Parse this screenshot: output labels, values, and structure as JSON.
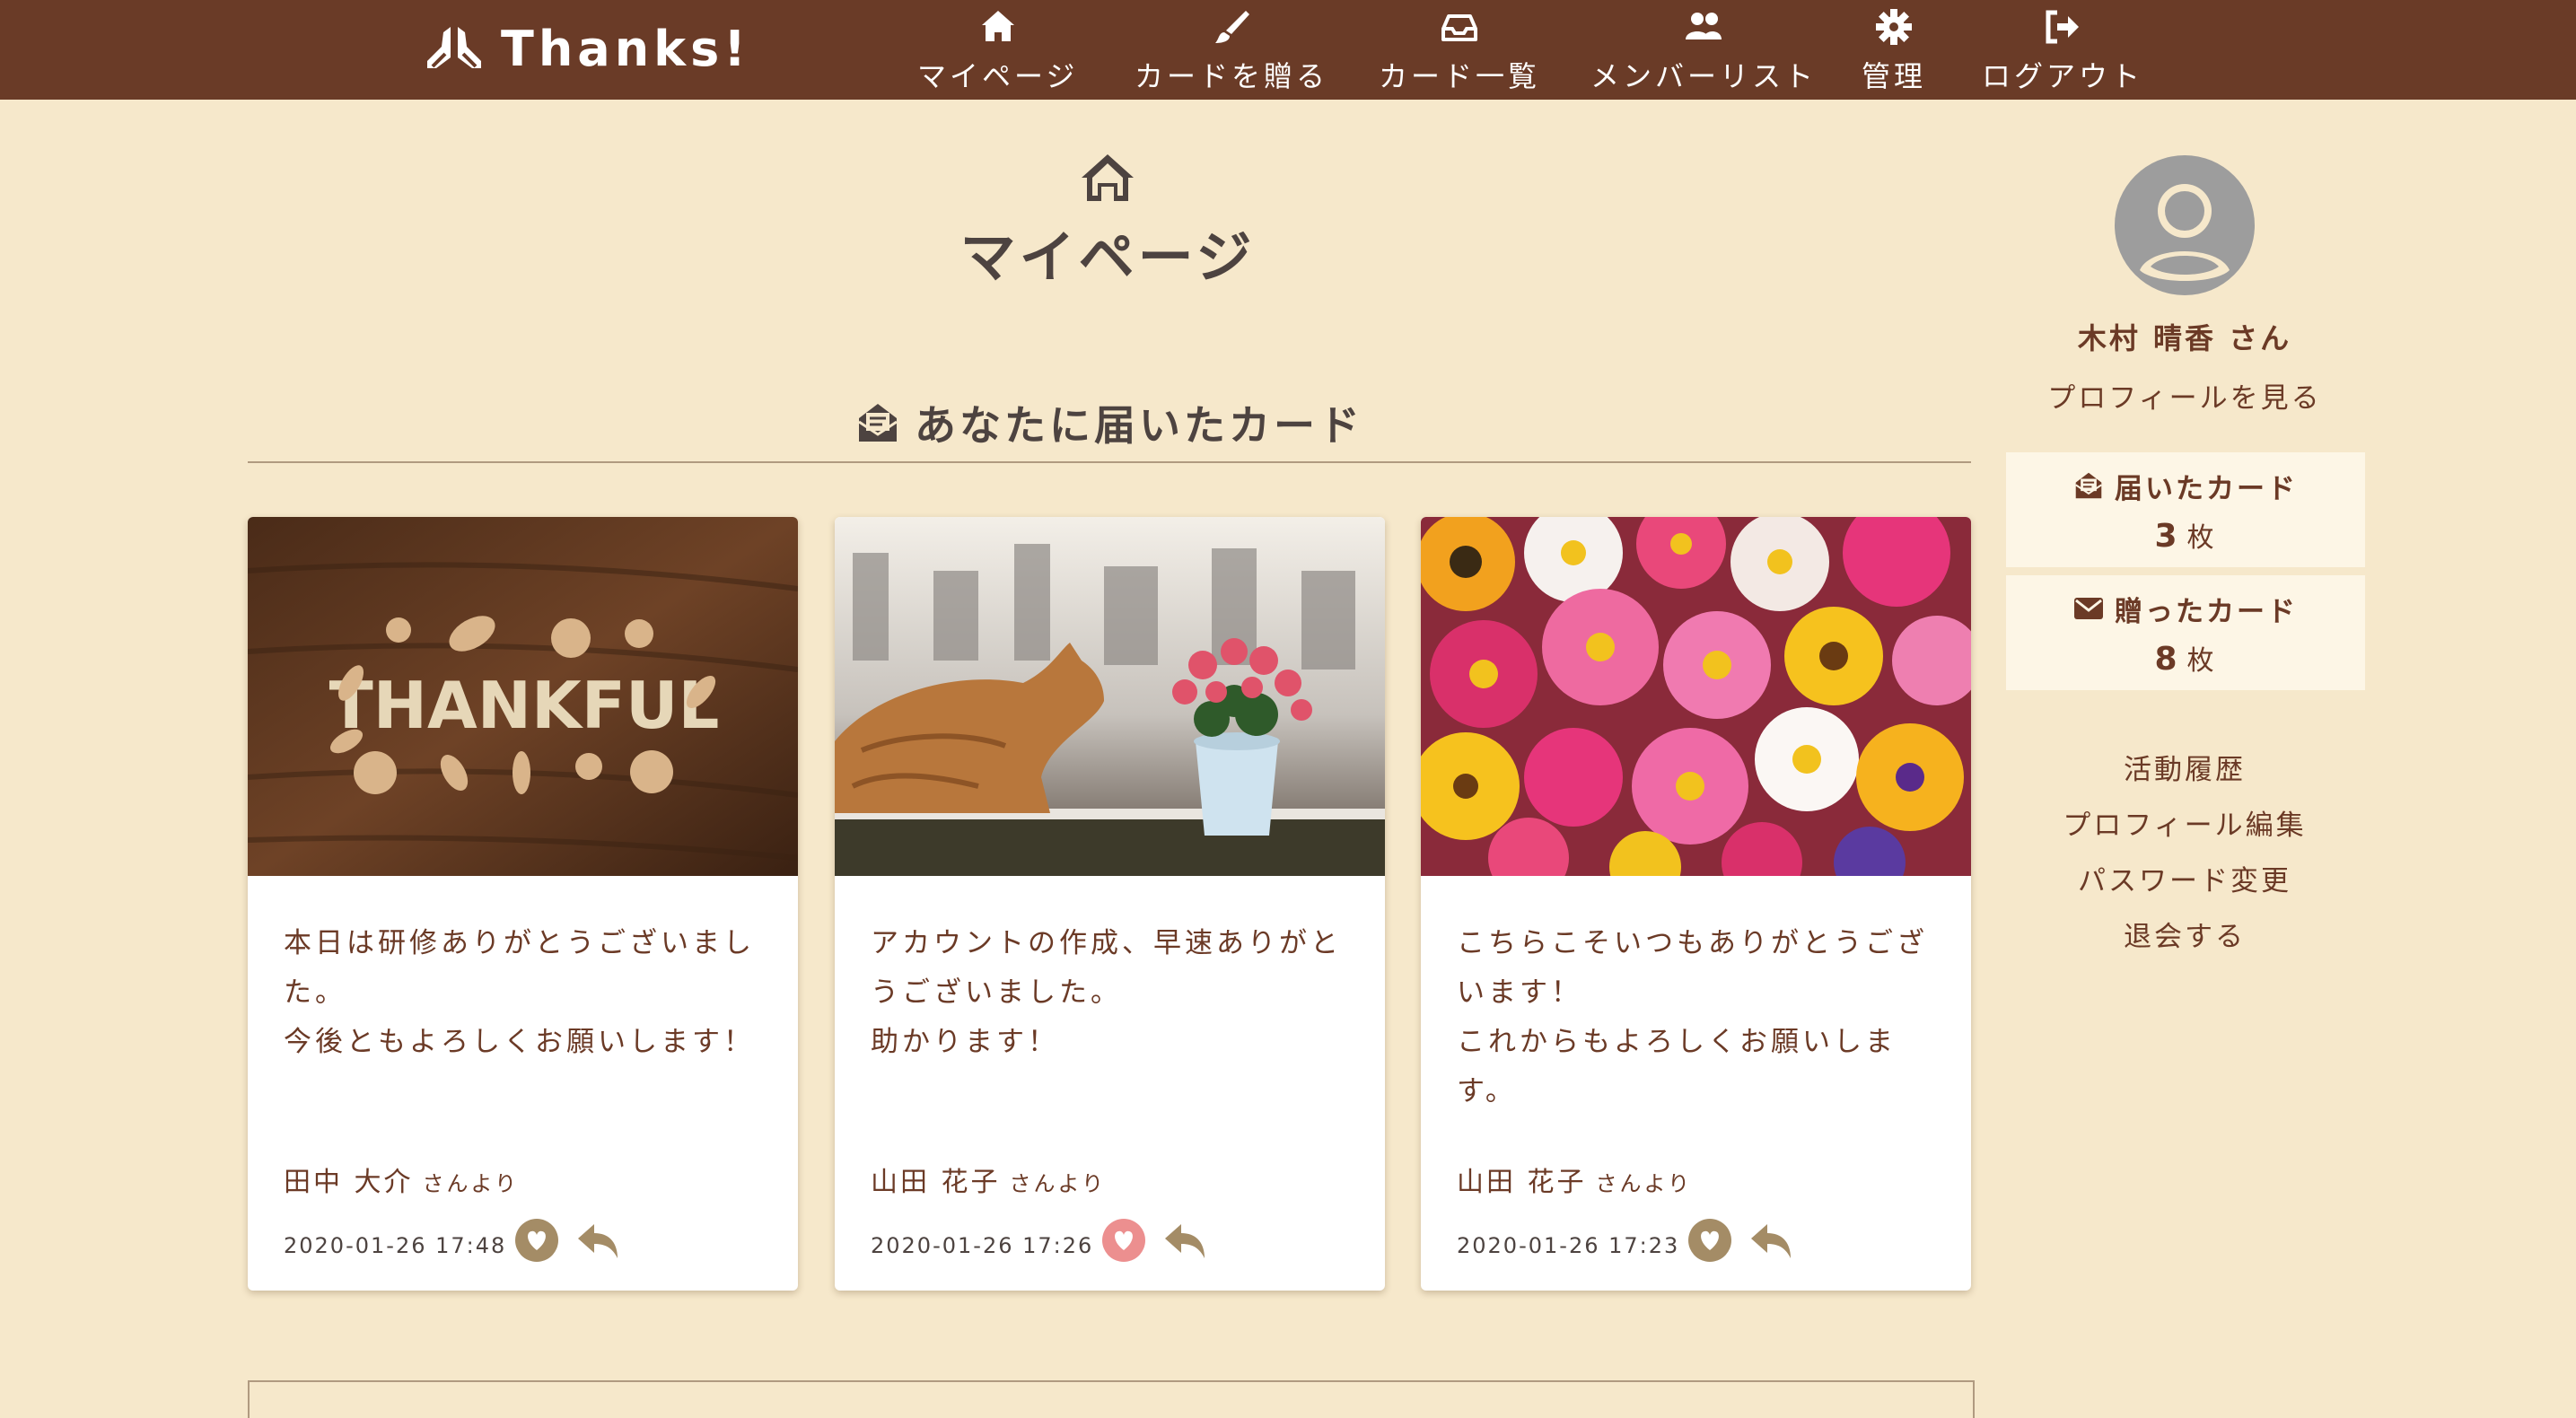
{
  "app": {
    "brand": "Thanks!",
    "brand_icon": "praying-hands-icon"
  },
  "nav": {
    "items": [
      {
        "label": "マイページ",
        "icon": "home-icon"
      },
      {
        "label": "カードを贈る",
        "icon": "brush-icon"
      },
      {
        "label": "カード一覧",
        "icon": "inbox-icon"
      },
      {
        "label": "メンバーリスト",
        "icon": "users-icon"
      },
      {
        "label": "管理",
        "icon": "gear-icon"
      },
      {
        "label": "ログアウト",
        "icon": "sign-out-icon"
      }
    ]
  },
  "page": {
    "title": "マイページ",
    "icon": "home-icon"
  },
  "section": {
    "title": "あなたに届いたカード",
    "icon": "envelope-open-icon"
  },
  "cards": [
    {
      "image": "autumn-thankful-photo",
      "image_text": "THANKFUL",
      "message": "本日は研修ありがとうございました。\n今後ともよろしくお願いします！",
      "from_name": "田中 大介",
      "from_suffix": "さんより",
      "date": "2020-01-26 17:48",
      "liked": false
    },
    {
      "image": "cat-and-flower-photo",
      "message": "アカウントの作成、早速ありがとうございました。\n助かります！",
      "from_name": "山田 花子",
      "from_suffix": "さんより",
      "date": "2020-01-26 17:26",
      "liked": true
    },
    {
      "image": "colorful-flowers-photo",
      "message": "こちらこそいつもありがとうございます！\nこれからもよろしくお願いします。",
      "from_name": "山田 花子",
      "from_suffix": "さんより",
      "date": "2020-01-26 17:23",
      "liked": false
    }
  ],
  "sidebar": {
    "user_name": "木村 晴香 さん",
    "profile_link": "プロフィールを見る",
    "received": {
      "label": "届いたカード",
      "count": "3",
      "unit": "枚",
      "icon": "envelope-open-icon"
    },
    "sent": {
      "label": "贈ったカード",
      "count": "8",
      "unit": "枚",
      "icon": "envelope-icon"
    },
    "links": [
      "活動履歴",
      "プロフィール編集",
      "パスワード変更",
      "退会する"
    ]
  },
  "colors": {
    "header": "#6a3b27",
    "background": "#f6e8cb",
    "text": "#6b3a26",
    "accent_tan": "#a48c66",
    "like_active": "#ec8f8f"
  }
}
